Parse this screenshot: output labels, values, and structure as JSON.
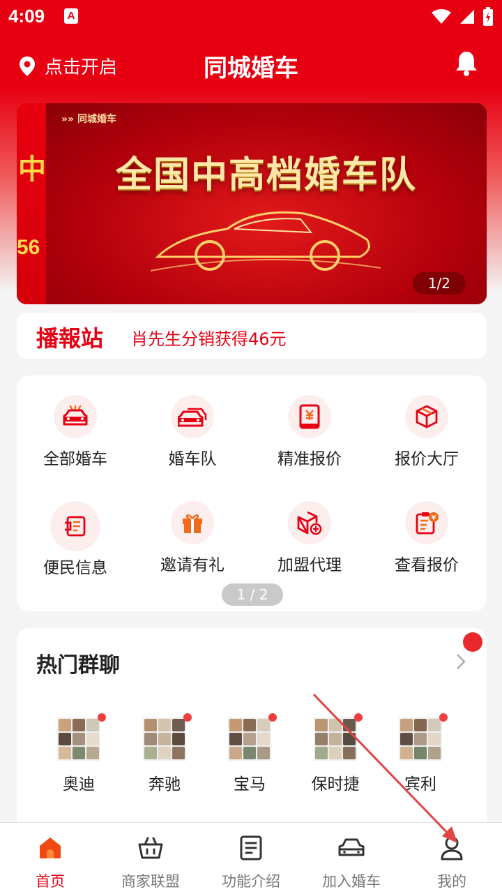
{
  "status_bar": {
    "time": "4:09",
    "notif_letter": "A"
  },
  "header": {
    "location_label": "点击开启",
    "title": "同城婚车"
  },
  "banner": {
    "left_peek_line1": "中",
    "left_peek_line2": "56",
    "tag": "同城婚车",
    "headline": "全国中高档婚车队",
    "page_indicator": "1/2"
  },
  "broadcast": {
    "label": "播報站",
    "message": "肖先生分销获得46元"
  },
  "grid": {
    "items": [
      {
        "label": "全部婚车",
        "icon": "car-front-icon"
      },
      {
        "label": "婚车队",
        "icon": "car-fleet-icon"
      },
      {
        "label": "精准报价",
        "icon": "yuan-document-icon"
      },
      {
        "label": "报价大厅",
        "icon": "cube-icon"
      },
      {
        "label": "便民信息",
        "icon": "info-card-icon"
      },
      {
        "label": "邀请有礼",
        "icon": "gift-icon"
      },
      {
        "label": "加盟代理",
        "icon": "box-plus-icon"
      },
      {
        "label": "查看报价",
        "icon": "clipboard-yuan-icon"
      }
    ],
    "page_indicator": "1 / 2"
  },
  "groups": {
    "title": "热门群聊",
    "items": [
      {
        "label": "奥迪"
      },
      {
        "label": "奔驰"
      },
      {
        "label": "宝马"
      },
      {
        "label": "保时捷"
      },
      {
        "label": "宾利"
      }
    ]
  },
  "tabbar": {
    "items": [
      {
        "label": "首页",
        "icon": "home-icon",
        "active": true
      },
      {
        "label": "商家联盟",
        "icon": "basket-icon",
        "active": false
      },
      {
        "label": "功能介绍",
        "icon": "document-icon",
        "active": false
      },
      {
        "label": "加入婚车",
        "icon": "car-icon",
        "active": false
      },
      {
        "label": "我的",
        "icon": "user-icon",
        "active": false
      }
    ]
  },
  "colors": {
    "brand_red": "#e60012",
    "annotation_arrow": "#e04545"
  }
}
